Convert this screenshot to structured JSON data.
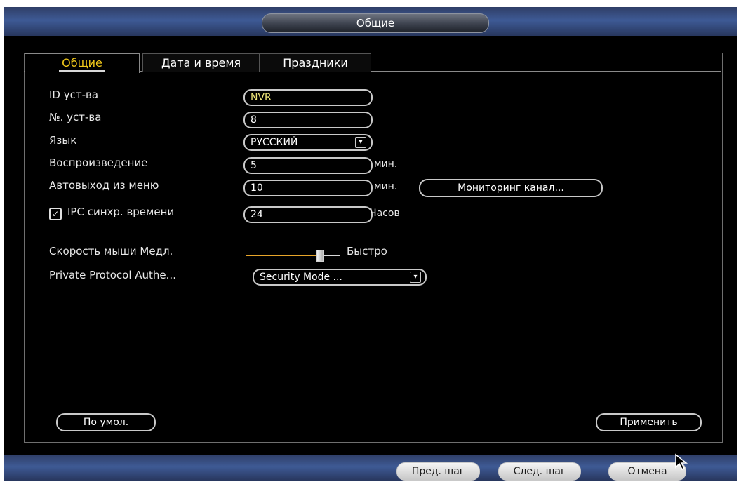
{
  "title": "Общие",
  "tabs": [
    {
      "label": "Общие",
      "active": true
    },
    {
      "label": "Дата и время",
      "active": false
    },
    {
      "label": "Праздники",
      "active": false
    }
  ],
  "fields": {
    "device_id": {
      "label": "ID уст-ва",
      "value": "NVR"
    },
    "device_no": {
      "label": "№. уст-ва",
      "value": "8"
    },
    "language": {
      "label": "Язык",
      "value": "РУССКИЙ"
    },
    "playback": {
      "label": "Воспроизведение",
      "value": "5",
      "unit": "мин."
    },
    "auto_logout": {
      "label": "Автовыход из меню",
      "value": "10",
      "unit": "мин.",
      "button": "Мониторинг канал..."
    },
    "ipc_sync": {
      "label": "IPC синхр. времени",
      "checked": true,
      "value": "24",
      "unit": "Часов"
    },
    "mouse_speed": {
      "label": "Скорость мыши",
      "min_label": "Медл.",
      "max_label": "Быстро",
      "level": 0.78
    },
    "private_protocol": {
      "label": "Private Protocol Authe...",
      "value": "Security Mode ..."
    }
  },
  "buttons": {
    "default": "По умол.",
    "apply": "Применить"
  },
  "footer": {
    "prev": "Пред. шаг",
    "next": "След. шаг",
    "cancel": "Отмена"
  },
  "colors": {
    "active_tab_text": "#f1c81a",
    "slider_fill": "#e7a52a",
    "header_blue": "#3e5a95"
  },
  "icons": {
    "checkbox": "check-icon",
    "dropdown": "chevron-down-icon",
    "cursor": "mouse-pointer-icon"
  }
}
